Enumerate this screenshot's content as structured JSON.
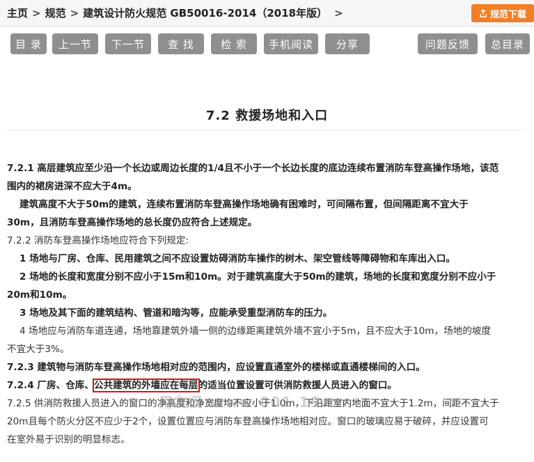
{
  "breadcrumb": {
    "home": "主页",
    "sep": ">",
    "category": "规范",
    "title": "建筑设计防火规范 GB50016-2014（2018年版）",
    "trail": ">"
  },
  "download_button": "规范下载",
  "toolbar": {
    "catalog": "目 录",
    "prev": "上一节",
    "next": "下一节",
    "find": "查 找",
    "search": "检 索",
    "mobile": "手机阅读",
    "share": "分享",
    "feedback": "问题反馈",
    "all_catalog": "总目录"
  },
  "section_title": "7.2  救援场地和入口",
  "content": {
    "p721_a": "7.2.1 高层建筑应至少沿一个长边或周边长度的1/4且不小于一个长边长度的底边连续布置消防车登高操作场地，该范",
    "p721_b": "围内的裙房进深不应大于4m。",
    "p721c_a": "建筑高度不大于50m的建筑，连续布置消防车登高操作场地确有困难时，可间隔布置，但间隔距离不宜大于",
    "p721c_b": "30m，且消防车登高操作场地的总长度仍应符合上述规定。",
    "p722": "7.2.2 消防车登高操作场地应符合下列规定:",
    "p722_1": "1 场地与厂房、仓库、民用建筑之间不应设置妨碍消防车操作的树木、架空管线等障碍物和车库出入口。",
    "p722_2a": "2 场地的长度和宽度分别不应小于15m和10m。对于建筑高度大于50m的建筑，场地的长度和宽度分别不应小于",
    "p722_2b": "20m和10m。",
    "p722_3": "3 场地及其下面的建筑结构、管道和暗沟等，应能承受重型消防车的压力。",
    "p722_4a": "4 场地应与消防车道连通，场地靠建筑外墙一侧的边缘距离建筑外墙不宜小于5m，且不应大于10m，场地的坡度",
    "p722_4b": "不宜大于3%。",
    "p723": "7.2.3 建筑物与消防车登高操作场地相对应的范围内，应设置直通室外的楼梯或直通楼梯间的入口。",
    "p724_pre": "7.2.4 厂房、仓库、",
    "p724_hl": "公共建筑的外墙应在每层",
    "p724_post": "的适当位置设置可供消防救援人员进入的窗口。",
    "p725_a": "7.2.5 供消防救援人员进入的窗口的净高度和净宽度均不应小于1.0m，下沿距室内地面不宜大于1.2m，间距不宜大于",
    "p725_b": "20m且每个防火分区不应少于2个，设置位置应与消防车登高操作场地相对应。窗口的玻璃应易于破碎，并应设置可",
    "p725_c": "在室外易于识别的明显标志。"
  },
  "watermark": "用友云  www.001  19.cn",
  "colors": {
    "toolbar_button": "#8f8f8f",
    "download_button": "#f07f25",
    "highlight_box": "#e01010"
  }
}
